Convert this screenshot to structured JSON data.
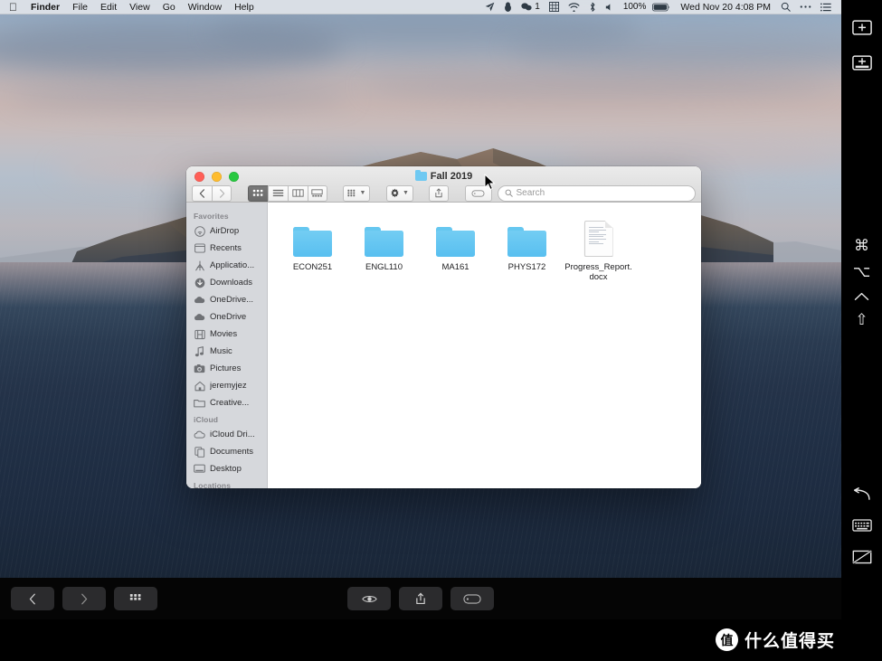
{
  "menubar": {
    "apple_icon": "apple-logo-icon",
    "items": [
      {
        "label": "Finder",
        "bold": true
      },
      {
        "label": "File",
        "bold": false
      },
      {
        "label": "Edit",
        "bold": false
      },
      {
        "label": "View",
        "bold": false
      },
      {
        "label": "Go",
        "bold": false
      },
      {
        "label": "Window",
        "bold": false
      },
      {
        "label": "Help",
        "bold": false
      }
    ],
    "status": {
      "telegram_icon": "paper-plane-icon",
      "qq_icon": "penguin-icon",
      "wechat_icon": "wechat-bubbles-icon",
      "wechat_badge": "1",
      "input_source_icon": "input-method-grid-icon",
      "wifi_icon": "wifi-icon",
      "bluetooth_icon": "bluetooth-icon",
      "volume_icon": "speaker-icon",
      "battery_percent": "100%",
      "battery_icon": "battery-full-icon",
      "datetime": "Wed Nov 20  4:08 PM",
      "spotlight_icon": "search-icon",
      "control_center_icon": "ellipsis-icon",
      "notification_icon": "list-lines-icon"
    }
  },
  "finder": {
    "title": "Fall 2019",
    "title_icon": "blue-folder-icon",
    "traffic_lights": {
      "close": "close-button",
      "minimize": "minimize-button",
      "zoom": "zoom-button"
    },
    "nav": {
      "back_icon": "chevron-left-icon",
      "forward_icon": "chevron-right-icon"
    },
    "view_modes": [
      {
        "name": "icon-view",
        "icon": "grid-icon",
        "selected": true
      },
      {
        "name": "list-view",
        "icon": "list-icon",
        "selected": false
      },
      {
        "name": "column-view",
        "icon": "columns-icon",
        "selected": false
      },
      {
        "name": "gallery-view",
        "icon": "gallery-icon",
        "selected": false
      }
    ],
    "arrange_button": {
      "name": "arrange-by",
      "icon": "group-grid-icon"
    },
    "action_button": {
      "name": "action-menu",
      "icon": "gear-icon"
    },
    "share_button": {
      "name": "share",
      "icon": "share-icon"
    },
    "tag_button": {
      "name": "tag",
      "icon": "tag-icon"
    },
    "search": {
      "placeholder": "Search",
      "value": "",
      "icon": "search-icon"
    },
    "sidebar": [
      {
        "type": "header",
        "label": "Favorites"
      },
      {
        "type": "item",
        "label": "AirDrop",
        "icon": "airdrop-icon"
      },
      {
        "type": "item",
        "label": "Recents",
        "icon": "clock-window-icon"
      },
      {
        "type": "item",
        "label": "Applicatio...",
        "icon": "applications-icon"
      },
      {
        "type": "item",
        "label": "Downloads",
        "icon": "download-arrow-icon"
      },
      {
        "type": "item",
        "label": "OneDrive...",
        "icon": "cloud-icon"
      },
      {
        "type": "item",
        "label": "OneDrive",
        "icon": "cloud-icon"
      },
      {
        "type": "item",
        "label": "Movies",
        "icon": "film-icon"
      },
      {
        "type": "item",
        "label": "Music",
        "icon": "music-note-icon"
      },
      {
        "type": "item",
        "label": "Pictures",
        "icon": "camera-icon"
      },
      {
        "type": "item",
        "label": "jeremyjez",
        "icon": "home-icon"
      },
      {
        "type": "item",
        "label": "Creative...",
        "icon": "folder-icon"
      },
      {
        "type": "header",
        "label": "iCloud"
      },
      {
        "type": "item",
        "label": "iCloud Dri...",
        "icon": "cloud-icon"
      },
      {
        "type": "item",
        "label": "Documents",
        "icon": "documents-icon"
      },
      {
        "type": "item",
        "label": "Desktop",
        "icon": "desktop-icon"
      },
      {
        "type": "header",
        "label": "Locations"
      }
    ],
    "files": [
      {
        "name": "ECON251",
        "kind": "folder"
      },
      {
        "name": "ENGL110",
        "kind": "folder"
      },
      {
        "name": "MA161",
        "kind": "folder"
      },
      {
        "name": "PHYS172",
        "kind": "folder"
      },
      {
        "name": "Progress_Report.docx",
        "kind": "document"
      }
    ]
  },
  "touchbar": {
    "left": [
      {
        "name": "touchbar-back",
        "icon": "chevron-left-icon"
      },
      {
        "name": "touchbar-forward",
        "icon": "chevron-right-icon"
      },
      {
        "name": "touchbar-view-grid",
        "icon": "grid-icon"
      }
    ],
    "center": [
      {
        "name": "touchbar-quicklook",
        "icon": "eye-icon"
      },
      {
        "name": "touchbar-share",
        "icon": "share-icon"
      },
      {
        "name": "touchbar-tag",
        "icon": "tag-icon"
      }
    ]
  },
  "rail": {
    "items": [
      {
        "name": "screen-capture-top",
        "icon": "screen-plus-icon"
      },
      {
        "name": "screen-capture-bottom",
        "icon": "screen-bar-plus-icon"
      },
      {
        "name": "command-key",
        "icon": "command-key-icon",
        "glyph": "⌘"
      },
      {
        "name": "option-key",
        "icon": "option-key-icon",
        "glyph": "⌥"
      },
      {
        "name": "control-key",
        "icon": "control-key-icon",
        "glyph": "˄"
      },
      {
        "name": "shift-key",
        "icon": "shift-key-icon",
        "glyph": "⇧"
      },
      {
        "name": "undo-back",
        "icon": "undo-arrow-icon"
      },
      {
        "name": "keyboard-toggle",
        "icon": "keyboard-icon"
      },
      {
        "name": "screen-off",
        "icon": "screen-off-icon"
      }
    ]
  },
  "watermark": {
    "badge": "值",
    "text": "什么值得买"
  },
  "colors": {
    "folder_blue": "#66c7f0",
    "accent": "#2b7fd4",
    "menubar_bg": "#ecedef",
    "sidebar_bg": "#d6d8dc",
    "rail_bg": "#000000"
  }
}
